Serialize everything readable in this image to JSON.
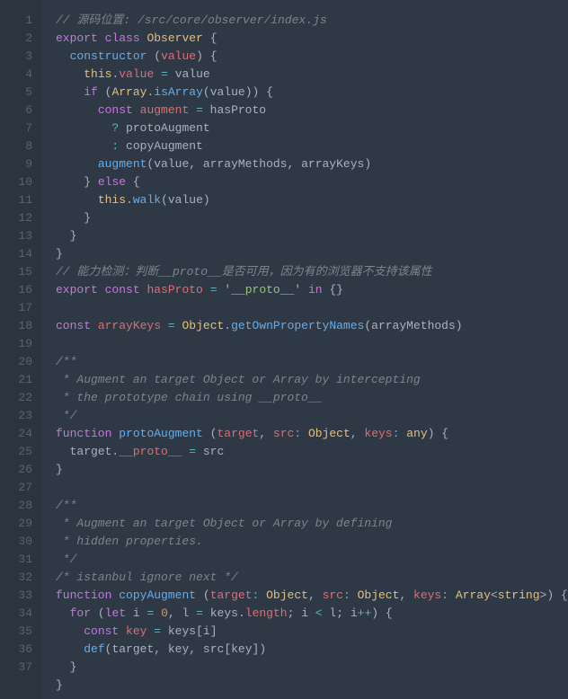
{
  "editor": {
    "language": "javascript",
    "filepath": "/src/core/observer/index.js",
    "gutter": [
      "1",
      "2",
      "3",
      "4",
      "5",
      "6",
      "7",
      "8",
      "9",
      "10",
      "11",
      "12",
      "13",
      "14",
      "15",
      "16",
      "17",
      "18",
      "19",
      "20",
      "21",
      "22",
      "23",
      "24",
      "25",
      "26",
      "27",
      "28",
      "29",
      "30",
      "31",
      "32",
      "33",
      "34",
      "35",
      "36",
      "37"
    ],
    "lines": [
      [
        [
          "comment",
          "// 源码位置: /src/core/observer/index.js"
        ]
      ],
      [
        [
          "keyword",
          "export"
        ],
        [
          "plain",
          " "
        ],
        [
          "keyword",
          "class"
        ],
        [
          "plain",
          " "
        ],
        [
          "class",
          "Observer"
        ],
        [
          "plain",
          " "
        ],
        [
          "punc",
          "{"
        ]
      ],
      [
        [
          "plain",
          "  "
        ],
        [
          "func",
          "constructor"
        ],
        [
          "plain",
          " "
        ],
        [
          "punc",
          "("
        ],
        [
          "param",
          "value"
        ],
        [
          "punc",
          ")"
        ],
        [
          "plain",
          " "
        ],
        [
          "punc",
          "{"
        ]
      ],
      [
        [
          "plain",
          "    "
        ],
        [
          "this",
          "this"
        ],
        [
          "punc",
          "."
        ],
        [
          "prop",
          "value"
        ],
        [
          "plain",
          " "
        ],
        [
          "op",
          "="
        ],
        [
          "plain",
          " "
        ],
        [
          "plain",
          "value"
        ]
      ],
      [
        [
          "plain",
          "    "
        ],
        [
          "keyword",
          "if"
        ],
        [
          "plain",
          " "
        ],
        [
          "punc",
          "("
        ],
        [
          "builtin",
          "Array"
        ],
        [
          "punc",
          "."
        ],
        [
          "method",
          "isArray"
        ],
        [
          "punc",
          "("
        ],
        [
          "plain",
          "value"
        ],
        [
          "punc",
          "))"
        ],
        [
          "plain",
          " "
        ],
        [
          "punc",
          "{"
        ]
      ],
      [
        [
          "plain",
          "      "
        ],
        [
          "keyword",
          "const"
        ],
        [
          "plain",
          " "
        ],
        [
          "prop",
          "augment"
        ],
        [
          "plain",
          " "
        ],
        [
          "op",
          "="
        ],
        [
          "plain",
          " hasProto"
        ]
      ],
      [
        [
          "plain",
          "        "
        ],
        [
          "op",
          "?"
        ],
        [
          "plain",
          " protoAugment"
        ]
      ],
      [
        [
          "plain",
          "        "
        ],
        [
          "op",
          ":"
        ],
        [
          "plain",
          " copyAugment"
        ]
      ],
      [
        [
          "plain",
          "      "
        ],
        [
          "method",
          "augment"
        ],
        [
          "punc",
          "("
        ],
        [
          "plain",
          "value"
        ],
        [
          "punc",
          ","
        ],
        [
          "plain",
          " arrayMethods"
        ],
        [
          "punc",
          ","
        ],
        [
          "plain",
          " arrayKeys"
        ],
        [
          "punc",
          ")"
        ]
      ],
      [
        [
          "plain",
          "    "
        ],
        [
          "punc",
          "}"
        ],
        [
          "plain",
          " "
        ],
        [
          "keyword",
          "else"
        ],
        [
          "plain",
          " "
        ],
        [
          "punc",
          "{"
        ]
      ],
      [
        [
          "plain",
          "      "
        ],
        [
          "this",
          "this"
        ],
        [
          "punc",
          "."
        ],
        [
          "method",
          "walk"
        ],
        [
          "punc",
          "("
        ],
        [
          "plain",
          "value"
        ],
        [
          "punc",
          ")"
        ]
      ],
      [
        [
          "plain",
          "    "
        ],
        [
          "punc",
          "}"
        ]
      ],
      [
        [
          "plain",
          "  "
        ],
        [
          "punc",
          "}"
        ]
      ],
      [
        [
          "punc",
          "}"
        ]
      ],
      [
        [
          "comment",
          "// 能力检测：判断__proto__是否可用，因为有的浏览器不支持该属性"
        ]
      ],
      [
        [
          "keyword",
          "export"
        ],
        [
          "plain",
          " "
        ],
        [
          "keyword",
          "const"
        ],
        [
          "plain",
          " "
        ],
        [
          "prop",
          "hasProto"
        ],
        [
          "plain",
          " "
        ],
        [
          "op",
          "="
        ],
        [
          "plain",
          " "
        ],
        [
          "string",
          "'__proto__'"
        ],
        [
          "plain",
          " "
        ],
        [
          "keyword",
          "in"
        ],
        [
          "plain",
          " "
        ],
        [
          "punc",
          "{}"
        ]
      ],
      [],
      [
        [
          "keyword",
          "const"
        ],
        [
          "plain",
          " "
        ],
        [
          "prop",
          "arrayKeys"
        ],
        [
          "plain",
          " "
        ],
        [
          "op",
          "="
        ],
        [
          "plain",
          " "
        ],
        [
          "builtin",
          "Object"
        ],
        [
          "punc",
          "."
        ],
        [
          "method",
          "getOwnPropertyNames"
        ],
        [
          "punc",
          "("
        ],
        [
          "plain",
          "arrayMethods"
        ],
        [
          "punc",
          ")"
        ]
      ],
      [],
      [
        [
          "comment",
          "/**"
        ]
      ],
      [
        [
          "comment",
          " * Augment an target Object or Array by intercepting"
        ]
      ],
      [
        [
          "comment",
          " * the prototype chain using __proto__"
        ]
      ],
      [
        [
          "comment",
          " */"
        ]
      ],
      [
        [
          "keyword",
          "function"
        ],
        [
          "plain",
          " "
        ],
        [
          "func",
          "protoAugment"
        ],
        [
          "plain",
          " "
        ],
        [
          "punc",
          "("
        ],
        [
          "param",
          "target"
        ],
        [
          "punc",
          ","
        ],
        [
          "plain",
          " "
        ],
        [
          "param",
          "src"
        ],
        [
          "op",
          ":"
        ],
        [
          "plain",
          " "
        ],
        [
          "builtin",
          "Object"
        ],
        [
          "punc",
          ","
        ],
        [
          "plain",
          " "
        ],
        [
          "param",
          "keys"
        ],
        [
          "op",
          ":"
        ],
        [
          "plain",
          " "
        ],
        [
          "builtin",
          "any"
        ],
        [
          "punc",
          ")"
        ],
        [
          "plain",
          " "
        ],
        [
          "punc",
          "{"
        ]
      ],
      [
        [
          "plain",
          "  "
        ],
        [
          "plain",
          "target"
        ],
        [
          "punc",
          "."
        ],
        [
          "prop",
          "__proto__"
        ],
        [
          "plain",
          " "
        ],
        [
          "op",
          "="
        ],
        [
          "plain",
          " src"
        ]
      ],
      [
        [
          "punc",
          "}"
        ]
      ],
      [],
      [
        [
          "comment",
          "/**"
        ]
      ],
      [
        [
          "comment",
          " * Augment an target Object or Array by defining"
        ]
      ],
      [
        [
          "comment",
          " * hidden properties."
        ]
      ],
      [
        [
          "comment",
          " */"
        ]
      ],
      [
        [
          "comment",
          "/* istanbul ignore next */"
        ]
      ],
      [
        [
          "keyword",
          "function"
        ],
        [
          "plain",
          " "
        ],
        [
          "func",
          "copyAugment"
        ],
        [
          "plain",
          " "
        ],
        [
          "punc",
          "("
        ],
        [
          "param",
          "target"
        ],
        [
          "op",
          ":"
        ],
        [
          "plain",
          " "
        ],
        [
          "builtin",
          "Object"
        ],
        [
          "punc",
          ","
        ],
        [
          "plain",
          " "
        ],
        [
          "param",
          "src"
        ],
        [
          "op",
          ":"
        ],
        [
          "plain",
          " "
        ],
        [
          "builtin",
          "Object"
        ],
        [
          "punc",
          ","
        ],
        [
          "plain",
          " "
        ],
        [
          "param",
          "keys"
        ],
        [
          "op",
          ":"
        ],
        [
          "plain",
          " "
        ],
        [
          "builtin",
          "Array"
        ],
        [
          "punc",
          "<"
        ],
        [
          "builtin",
          "string"
        ],
        [
          "punc",
          ">"
        ],
        [
          "punc",
          ")"
        ],
        [
          "plain",
          " "
        ],
        [
          "punc",
          "{"
        ]
      ],
      [
        [
          "plain",
          "  "
        ],
        [
          "keyword",
          "for"
        ],
        [
          "plain",
          " "
        ],
        [
          "punc",
          "("
        ],
        [
          "keyword",
          "let"
        ],
        [
          "plain",
          " "
        ],
        [
          "plain",
          "i "
        ],
        [
          "op",
          "="
        ],
        [
          "plain",
          " "
        ],
        [
          "number",
          "0"
        ],
        [
          "punc",
          ","
        ],
        [
          "plain",
          " l "
        ],
        [
          "op",
          "="
        ],
        [
          "plain",
          " keys"
        ],
        [
          "punc",
          "."
        ],
        [
          "prop",
          "length"
        ],
        [
          "punc",
          ";"
        ],
        [
          "plain",
          " i "
        ],
        [
          "op",
          "<"
        ],
        [
          "plain",
          " l"
        ],
        [
          "punc",
          ";"
        ],
        [
          "plain",
          " i"
        ],
        [
          "op",
          "++"
        ],
        [
          "punc",
          ")"
        ],
        [
          "plain",
          " "
        ],
        [
          "punc",
          "{"
        ]
      ],
      [
        [
          "plain",
          "    "
        ],
        [
          "keyword",
          "const"
        ],
        [
          "plain",
          " "
        ],
        [
          "prop",
          "key"
        ],
        [
          "plain",
          " "
        ],
        [
          "op",
          "="
        ],
        [
          "plain",
          " keys"
        ],
        [
          "punc",
          "["
        ],
        [
          "plain",
          "i"
        ],
        [
          "punc",
          "]"
        ]
      ],
      [
        [
          "plain",
          "    "
        ],
        [
          "method",
          "def"
        ],
        [
          "punc",
          "("
        ],
        [
          "plain",
          "target"
        ],
        [
          "punc",
          ","
        ],
        [
          "plain",
          " key"
        ],
        [
          "punc",
          ","
        ],
        [
          "plain",
          " src"
        ],
        [
          "punc",
          "["
        ],
        [
          "plain",
          "key"
        ],
        [
          "punc",
          "])"
        ]
      ],
      [
        [
          "plain",
          "  "
        ],
        [
          "punc",
          "}"
        ]
      ],
      [
        [
          "punc",
          "}"
        ]
      ]
    ]
  }
}
